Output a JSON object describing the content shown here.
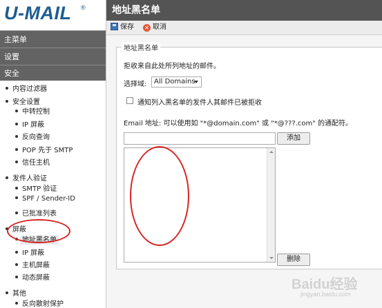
{
  "brand": {
    "logo": "U-MAIL",
    "logo_mark": "®"
  },
  "menu": {
    "main": "主菜单",
    "settings": "设置",
    "security": "安全"
  },
  "tree": {
    "content_filter": "内容过滤器",
    "security_settings": "安全设置",
    "relay_control": "中转控制",
    "ip_shield": "IP 屏蔽",
    "reverse_lookup": "反向查询",
    "pop_before_smtp": "POP 先于 SMTP",
    "trusted_hosts": "信任主机",
    "sender_auth": "发件人验证",
    "smtp_auth": "SMTP 验证",
    "spf": "SPF / Sender-ID",
    "approved_list": "已批准列表",
    "blocking": "屏蔽",
    "address_blacklist": "地址黑名单",
    "ip_block": "IP 屏蔽",
    "host_block": "主机屏蔽",
    "dynamic_block": "动态屏蔽",
    "other": "其他",
    "backscatter": "反向散射保护"
  },
  "page": {
    "title": "地址黑名单"
  },
  "toolbar": {
    "save": "保存",
    "cancel": "取消"
  },
  "form": {
    "legend": "地址黑名单",
    "description": "拒收来自此处所列地址的邮件。",
    "domain_label": "选择域:",
    "domain_value": "All Domains",
    "notify_label": "通知列入黑名单的发件人其邮件已被拒收",
    "notify_checked": false,
    "email_hint": "Email 地址: 可以使用如 \"*@domain.com\" 或 \"*@???.com\" 的通配符。",
    "email_value": "",
    "add": "添加",
    "remove": "删除",
    "entries": []
  },
  "watermark": {
    "text": "Baidu经验",
    "sub": "jingyan.baidu.com"
  },
  "colors": {
    "logo": "#1f5c93",
    "title_bar": "#545454",
    "menu_bar": "#636363",
    "annotation": "#d72424"
  }
}
